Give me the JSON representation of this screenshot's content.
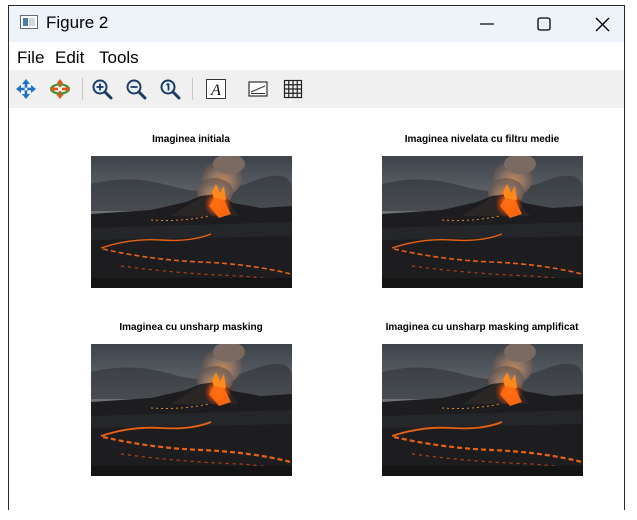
{
  "window": {
    "title": "Figure 2"
  },
  "menu": {
    "file": "File",
    "edit": "Edit",
    "tools": "Tools"
  },
  "toolbar": {
    "tools": [
      "pan-icon",
      "rotate-icon",
      "zoom-in-icon",
      "zoom-out-icon",
      "zoom-reset-icon",
      "insert-text-icon",
      "insert-legend-icon",
      "grid-icon"
    ],
    "accent": "#1a73c8"
  },
  "subplots": [
    {
      "title": "Imaginea initiala",
      "image": "volcano-eruption"
    },
    {
      "title": "Imaginea nivelata cu filtru medie",
      "image": "volcano-eruption"
    },
    {
      "title": "Imaginea cu unsharp masking",
      "image": "volcano-eruption"
    },
    {
      "title": "Imaginea cu unsharp masking amplificat",
      "image": "volcano-eruption"
    }
  ],
  "colors": {
    "titlebar": "#eef3f9",
    "toolbar": "#f0f0f0",
    "lava": "#ff6a10",
    "smoke": "#8a7266"
  }
}
